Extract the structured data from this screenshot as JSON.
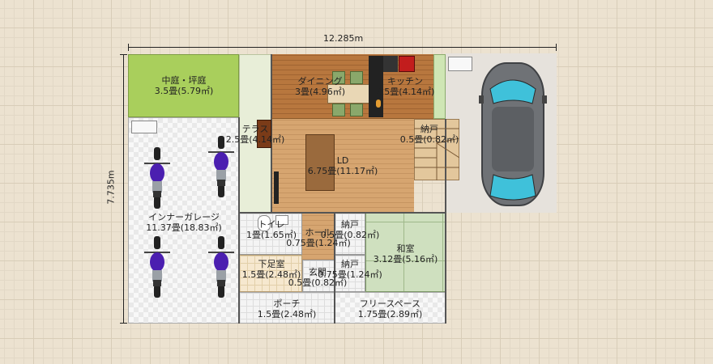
{
  "dimensions": {
    "width": "12.285m",
    "height": "7.735m"
  },
  "rooms": {
    "courtyard": {
      "name": "中庭・坪庭",
      "area": "3.5畳(5.79㎡)"
    },
    "dining": {
      "name": "ダイニング",
      "area": "3畳(4.96㎡)"
    },
    "kitchen": {
      "name": "キッチン",
      "area": "2.5畳(4.14㎡)"
    },
    "terrace": {
      "name": "テラス",
      "area": "2.5畳(4.14㎡)"
    },
    "storage1": {
      "name": "納戸",
      "area": "0.5畳(0.82㎡)"
    },
    "ld": {
      "name": "LD",
      "area": "6.75畳(11.17㎡)"
    },
    "garage": {
      "name": "インナーガレージ",
      "area": "11.37畳(18.83㎡)"
    },
    "toilet": {
      "name": "トイレ",
      "area": "1畳(1.65㎡)"
    },
    "hall": {
      "name": "ホール",
      "area": "0.75畳(1.24㎡)"
    },
    "storage2": {
      "name": "納戸",
      "area": "0.5畳(0.82㎡)"
    },
    "washitsu": {
      "name": "和室",
      "area": "3.12畳(5.16㎡)"
    },
    "shoe_room": {
      "name": "下足室",
      "area": "1.5畳(2.48㎡)"
    },
    "genkan": {
      "name": "玄関",
      "area": "0.5畳(0.82㎡)"
    },
    "storage3": {
      "name": "納戸",
      "area": "0.75畳(1.24㎡)"
    },
    "porch": {
      "name": "ポーチ",
      "area": "1.5畳(2.48㎡)"
    },
    "free_space": {
      "name": "フリースペース",
      "area": "1.75畳(2.89㎡)"
    }
  },
  "icons": [
    "motorcycle-icon",
    "car-icon",
    "sink-icon",
    "stove-icon",
    "refrigerator-icon",
    "sofa-icon",
    "tv-icon",
    "stairs-icon",
    "toilet-icon",
    "dining-table-icon"
  ],
  "colors": {
    "garden": "#a9cf5c",
    "car_body": "#6f7276",
    "bike_tank": "#4b1fb0"
  }
}
